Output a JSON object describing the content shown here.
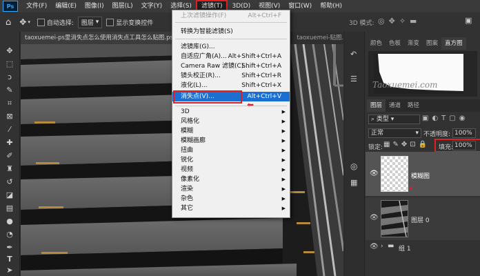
{
  "menubar": {
    "logo": "Ps",
    "items": [
      "文件(F)",
      "编辑(E)",
      "图像(I)",
      "图层(L)",
      "文字(Y)",
      "选择(S)",
      "滤镜(T)",
      "3D(D)",
      "视图(V)",
      "窗口(W)",
      "帮助(H)"
    ],
    "active_index": 6
  },
  "options": {
    "auto_select_label": "自动选择:",
    "auto_select_value": "图层",
    "show_transform_label": "显示变换控件",
    "mode_3d": "3D 模式:"
  },
  "tabs": [
    {
      "label": "taoxuemei-ps里消失点怎么使用消失点工具怎么贴图.ps"
    },
    {
      "label": "taoxuemei-贴图.jpg"
    }
  ],
  "filter_menu": {
    "items": [
      {
        "label": "上次滤镜操作(F)",
        "shortcut": "Alt+Ctrl+F",
        "disabled": true
      },
      {
        "sep": true
      },
      {
        "label": "转换为智能滤镜(S)"
      },
      {
        "sep": true
      },
      {
        "label": "滤镜库(G)..."
      },
      {
        "label": "自适应广角(A)...",
        "shortcut": "Alt+Shift+Ctrl+A"
      },
      {
        "label": "Camera Raw 滤镜(C)...",
        "shortcut": "Shift+Ctrl+A"
      },
      {
        "label": "镜头校正(R)...",
        "shortcut": "Shift+Ctrl+R"
      },
      {
        "label": "液化(L)...",
        "shortcut": "Shift+Ctrl+X"
      },
      {
        "label": "消失点(V)...",
        "shortcut": "Alt+Ctrl+V",
        "highlight": true
      },
      {
        "sep": true
      },
      {
        "label": "3D",
        "sub": true
      },
      {
        "label": "风格化",
        "sub": true
      },
      {
        "label": "模糊",
        "sub": true
      },
      {
        "label": "模糊画廊",
        "sub": true
      },
      {
        "label": "扭曲",
        "sub": true
      },
      {
        "label": "锐化",
        "sub": true
      },
      {
        "label": "视频",
        "sub": true
      },
      {
        "label": "像素化",
        "sub": true
      },
      {
        "label": "渲染",
        "sub": true
      },
      {
        "label": "杂色",
        "sub": true
      },
      {
        "label": "其它",
        "sub": true
      }
    ]
  },
  "right_panel": {
    "top_tabs": [
      "颜色",
      "色板",
      "渐变",
      "图案",
      "直方图"
    ],
    "watermark": "Taoxuemei.com",
    "layer_tabs": [
      "图层",
      "通道",
      "路径"
    ],
    "kind_filter": "类型",
    "blend_mode": "正常",
    "opacity_label": "不透明度:",
    "opacity_value": "100%",
    "lock_label": "锁定:",
    "fill_label": "填充:",
    "fill_value": "100%",
    "layers": [
      {
        "name": "模糊图"
      },
      {
        "name": "图层 0"
      },
      {
        "name": "组 1"
      }
    ]
  },
  "colors": {
    "menubar": "#3a3a3a",
    "highlight": "#1a6fd1",
    "annotation_red": "#e02020"
  }
}
